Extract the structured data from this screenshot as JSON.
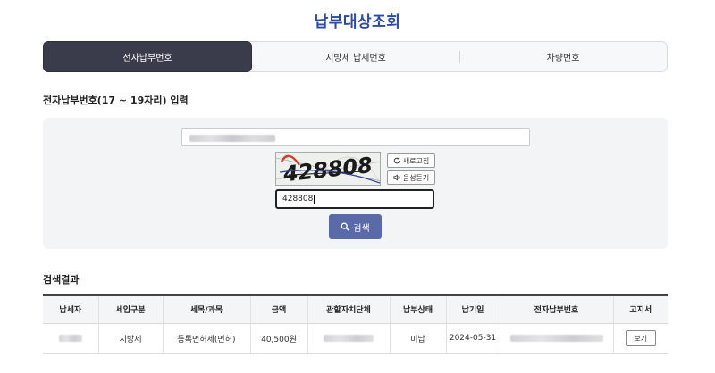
{
  "page": {
    "title": "납부대상조회"
  },
  "tabs": [
    {
      "label": "전자납부번호",
      "active": true
    },
    {
      "label": "지방세 납세번호",
      "active": false
    },
    {
      "label": "차량번호",
      "active": false
    }
  ],
  "input_section": {
    "label": "전자납부번호(17 ~ 19자리) 입력"
  },
  "captcha": {
    "image_text": "428808",
    "refresh_label": "새로고침",
    "audio_label": "음성듣기",
    "input_value": "428808"
  },
  "search_button": {
    "label": "검색",
    "color": "#5a6aa8"
  },
  "results": {
    "label": "검색결과",
    "columns": [
      "납세자",
      "세입구분",
      "세목/과목",
      "금액",
      "관할자치단체",
      "납부상태",
      "납기일",
      "전자납부번호",
      "고지서"
    ],
    "rows": [
      {
        "tax_type": "지방세",
        "item": "등록면허세(면허)",
        "amount": "40,500원",
        "status": "미납",
        "due_date": "2024-05-31",
        "view_label": "보기"
      }
    ]
  },
  "colors": {
    "title": "#2c4ba8",
    "active_tab": "#3b3c4b"
  }
}
